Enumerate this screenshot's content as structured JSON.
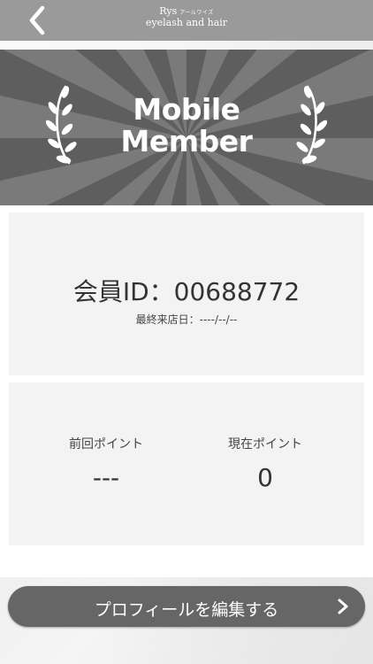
{
  "header": {
    "brand_name": "Rys",
    "brand_kana": "アールワイズ",
    "brand_subtitle": "eyelash and hair",
    "back_icon": "chevron-left-icon"
  },
  "hero": {
    "title_line1": "Mobile",
    "title_line2": "Member",
    "background_color": "#5e5e5e",
    "decoration_icon": "laurel-icon"
  },
  "member": {
    "id_text": "会員ID：00688772",
    "last_visit_text": "最終来店日：----/--/--"
  },
  "points": {
    "previous_label": "前回ポイント",
    "previous_value": "---",
    "current_label": "現在ポイント",
    "current_value": "0"
  },
  "actions": {
    "edit_profile_label": "プロフィールを編集する",
    "chevron_icon": "chevron-right-icon",
    "button_color": "#666666"
  }
}
